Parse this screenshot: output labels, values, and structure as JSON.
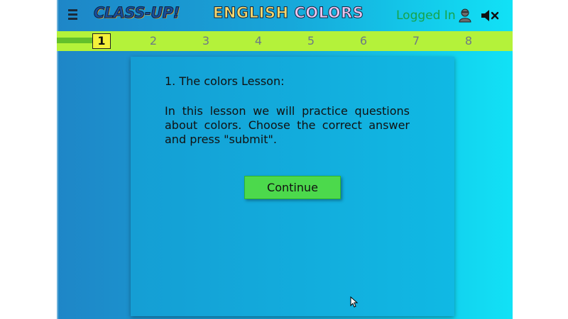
{
  "header": {
    "menu_icon": "hamburger-icon",
    "logo": "CLASS-UP!",
    "title_word1": "ENGLISH",
    "title_word2": "COLORS",
    "logged_in_label": "Logged In",
    "user_icon": "user-icon",
    "mute_icon": "speaker-muted-icon"
  },
  "progress": {
    "current_step": 1,
    "steps": [
      "1",
      "2",
      "3",
      "4",
      "5",
      "6",
      "7",
      "8"
    ]
  },
  "lesson": {
    "title": "1. The colors Lesson:",
    "body": "In this lesson we will practice questions about colors. Choose the correct answer and press \"submit\".",
    "continue_label": "Continue"
  },
  "colors": {
    "progress_bar": "#b4f23a",
    "active_step": "#f4f03a",
    "button": "#4cd94c",
    "logged_in_text": "#16a34a"
  }
}
